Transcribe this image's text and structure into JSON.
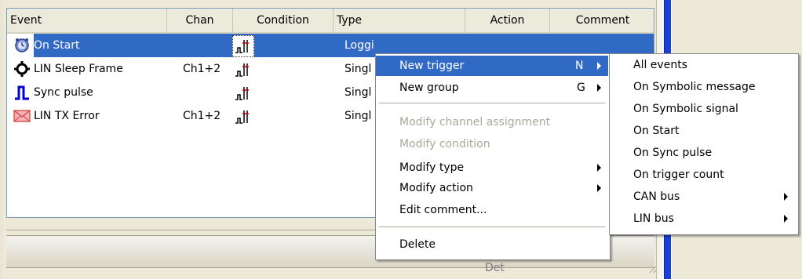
{
  "table": {
    "columns": [
      "Event",
      "Chan",
      "Condition",
      "Type",
      "Action",
      "Comment"
    ],
    "rows": [
      {
        "event": "On Start",
        "chan": "",
        "type": "Loggi",
        "icon": "clock-icon",
        "selected": true
      },
      {
        "event": "LIN Sleep Frame",
        "chan": "Ch1+2",
        "type": "Singl",
        "icon": "gear-icon",
        "selected": false
      },
      {
        "event": "Sync pulse",
        "chan": "",
        "type": "Singl",
        "icon": "pulse-icon",
        "selected": false
      },
      {
        "event": "LIN TX Error",
        "chan": "Ch1+2",
        "type": "Singl",
        "icon": "error-envelope-icon",
        "selected": false
      }
    ]
  },
  "context_menu": {
    "items": [
      {
        "label": "New trigger",
        "shortcut": "N",
        "submenu": true,
        "highlighted": true,
        "disabled": false
      },
      {
        "label": "New group",
        "shortcut": "G",
        "submenu": true,
        "highlighted": false,
        "disabled": false
      },
      {
        "label": "Modify channel assignment",
        "disabled": true
      },
      {
        "label": "Modify condition",
        "disabled": true
      },
      {
        "label": "Modify type",
        "submenu": true,
        "disabled": false
      },
      {
        "label": "Modify action",
        "submenu": true,
        "disabled": false
      },
      {
        "label": "Edit comment...",
        "disabled": false
      },
      {
        "label": "Delete",
        "disabled": false
      }
    ]
  },
  "submenu": {
    "items": [
      {
        "label": "All events",
        "submenu": false
      },
      {
        "label": "On Symbolic message",
        "submenu": false
      },
      {
        "label": "On Symbolic signal",
        "submenu": false
      },
      {
        "label": "On Start",
        "submenu": false
      },
      {
        "label": "On Sync pulse",
        "submenu": false
      },
      {
        "label": "On trigger count",
        "submenu": false
      },
      {
        "label": "CAN bus",
        "submenu": true
      },
      {
        "label": "LIN bus",
        "submenu": true
      }
    ]
  },
  "lower_panel": {
    "partial_text": "Det"
  },
  "colors": {
    "selection": "#316ac5",
    "accent_bar": "#1a3fd6"
  }
}
